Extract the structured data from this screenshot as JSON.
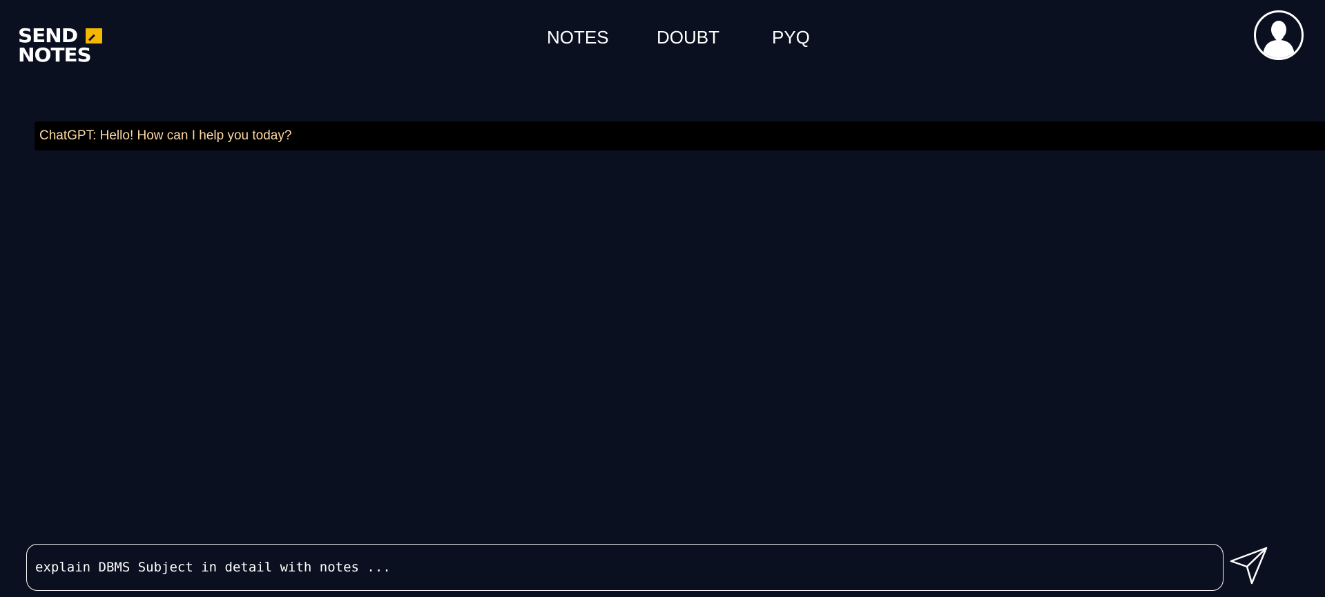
{
  "logo": {
    "line1": "SEND",
    "line2": "NOTES",
    "accent_color": "#f5b800"
  },
  "nav": {
    "items": [
      {
        "label": "NOTES"
      },
      {
        "label": "DOUBT"
      },
      {
        "label": "PYQ"
      }
    ]
  },
  "profile": {
    "icon": "user-avatar-icon"
  },
  "chat": {
    "messages": [
      {
        "text": "ChatGPT: Hello! How can I help you today?"
      }
    ]
  },
  "composer": {
    "placeholder": "explain DBMS Subject in detail with notes ...",
    "value": ""
  },
  "send": {
    "icon": "send-paper-plane-icon"
  },
  "colors": {
    "background": "#0b1020",
    "message_background": "#000000",
    "message_text": "#ffd9a6",
    "brand_accent": "#f5b800"
  }
}
